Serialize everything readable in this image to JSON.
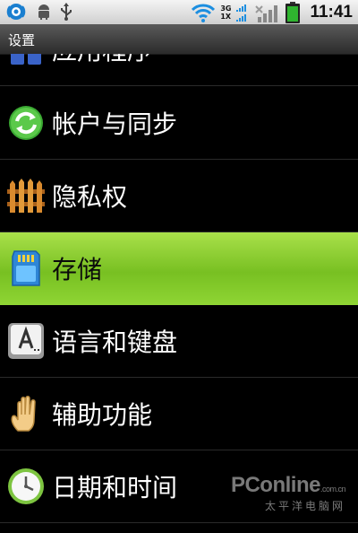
{
  "status_bar": {
    "time": "11:41",
    "network_labels": [
      "3G",
      "1X"
    ],
    "icons": [
      "wifi-hotspot-icon",
      "android-debug-icon",
      "usb-icon",
      "wifi-signal-icon",
      "signal-3g-icon",
      "signal-1x-icon",
      "signal-strength-icon",
      "battery-icon"
    ]
  },
  "title_bar": {
    "title": "设置"
  },
  "settings_list": [
    {
      "label": "应用程序",
      "icon": "apps-icon"
    },
    {
      "label": "帐户与同步",
      "icon": "sync-icon"
    },
    {
      "label": "隐私权",
      "icon": "privacy-fence-icon"
    },
    {
      "label": "存储",
      "icon": "sd-card-icon",
      "selected": true
    },
    {
      "label": "语言和键盘",
      "icon": "keyboard-key-icon"
    },
    {
      "label": "辅助功能",
      "icon": "hand-icon"
    },
    {
      "label": "日期和时间",
      "icon": "clock-icon"
    }
  ],
  "watermark": {
    "line1": "PConline",
    "domain": ".com.cn",
    "line2": "太平洋电脑网"
  },
  "colors": {
    "selected_bg": "#8cd234",
    "status_bg": "#e6e6e6",
    "title_bg": "#3d3d3d",
    "list_bg": "#000000"
  }
}
